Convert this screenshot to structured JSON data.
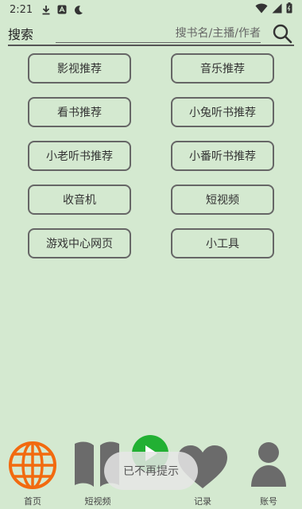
{
  "status": {
    "time": "2:21"
  },
  "search": {
    "label": "搜索",
    "placeholder": "搜书名/主播/作者"
  },
  "categories": [
    "影视推荐",
    "音乐推荐",
    "看书推荐",
    "小兔听书推荐",
    "小老听书推荐",
    "小番听书推荐",
    "收音机",
    "短视频",
    "游戏中心网页",
    "小工具"
  ],
  "nav": {
    "home": "首页",
    "short_video": "短视频",
    "records": "记录",
    "account": "账号"
  },
  "toast": {
    "text": "已不再提示"
  },
  "colors": {
    "background": "#d4e9d0",
    "accent_green": "#22b033",
    "home_orange": "#f26a0f",
    "icon_gray": "#6b6b6b"
  }
}
